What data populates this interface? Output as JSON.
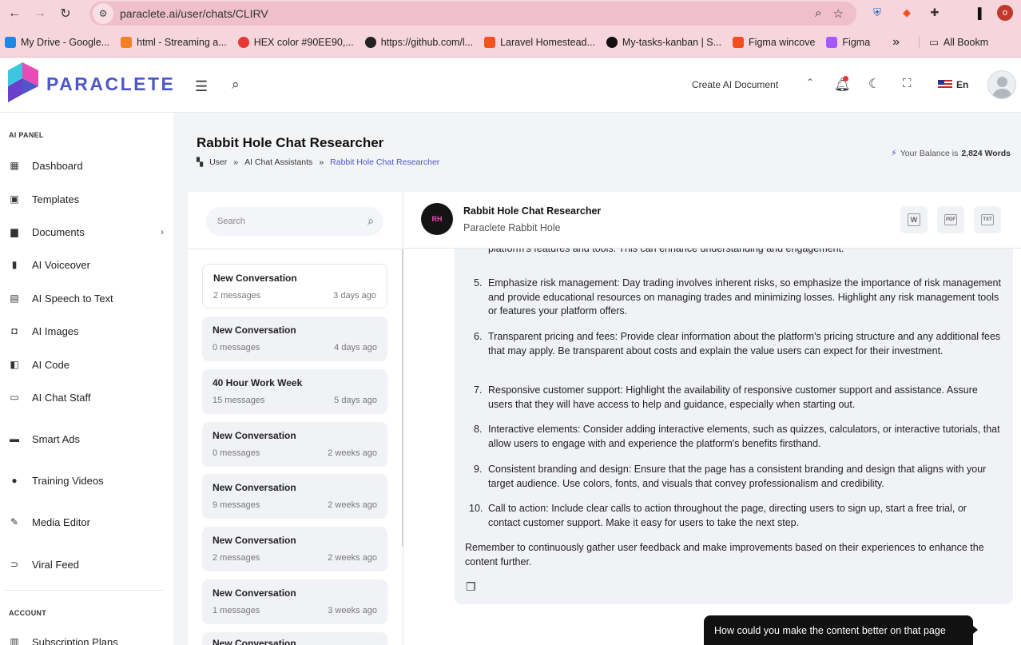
{
  "browser": {
    "url": "paraclete.ai/user/chats/CLIRV",
    "profile_initial": "o",
    "bookmarks": [
      {
        "label": "My Drive - Google...",
        "color": "#1e88e5"
      },
      {
        "label": "html - Streaming a...",
        "color": "#f48024"
      },
      {
        "label": "HEX color #90EE90,...",
        "color": "#e53935"
      },
      {
        "label": "https://github.com/l...",
        "color": "#222222"
      },
      {
        "label": "Laravel Homestead...",
        "color": "#f4511e"
      },
      {
        "label": "My-tasks-kanban | S...",
        "color": "#111111"
      },
      {
        "label": "Figma wincove",
        "color": "#f24e1e"
      },
      {
        "label": "Figma",
        "color": "#a259ff"
      }
    ],
    "more_bookmarks": "»",
    "all_bookmarks": "All Bookm"
  },
  "header": {
    "brand": "PARACLETE",
    "create_doc": "Create AI Document",
    "language": "En"
  },
  "sidebar": {
    "section_ai": "AI PANEL",
    "items": [
      {
        "label": "Dashboard",
        "icon": "dashboard-icon",
        "glyph": "▦"
      },
      {
        "label": "Templates",
        "icon": "templates-icon",
        "glyph": "▣"
      },
      {
        "label": "Documents",
        "icon": "documents-icon",
        "glyph": "▆"
      },
      {
        "label": "AI Voiceover",
        "icon": "voiceover-icon",
        "glyph": "▮"
      },
      {
        "label": "AI Speech to Text",
        "icon": "speech-icon",
        "glyph": "▤"
      },
      {
        "label": "AI Images",
        "icon": "images-icon",
        "glyph": "◘"
      },
      {
        "label": "AI Code",
        "icon": "code-icon",
        "glyph": "◧"
      },
      {
        "label": "AI Chat Staff",
        "icon": "chat-staff-icon",
        "glyph": "▭"
      },
      {
        "label": "Smart Ads",
        "icon": "ads-icon",
        "glyph": "▬"
      },
      {
        "label": "Training Videos",
        "icon": "video-icon",
        "glyph": "●"
      },
      {
        "label": "Media Editor",
        "icon": "edit-icon",
        "glyph": "✎"
      },
      {
        "label": "Viral Feed",
        "icon": "rss-icon",
        "glyph": "⊃"
      }
    ],
    "section_account": "ACCOUNT",
    "account_items": [
      {
        "label": "Subscription Plans",
        "icon": "plans-icon",
        "glyph": "▥"
      }
    ]
  },
  "page": {
    "title": "Rabbit Hole Chat Researcher",
    "breadcrumb": [
      "User",
      "AI Chat Assistants",
      "Rabbit Hole Chat Researcher"
    ],
    "balance_label": "Your Balance is",
    "balance_value": "2,824 Words"
  },
  "conversations": {
    "search_placeholder": "Search",
    "items": [
      {
        "title": "New Conversation",
        "messages": "2 messages",
        "date": "3 days ago"
      },
      {
        "title": "New Conversation",
        "messages": "0 messages",
        "date": "4 days ago"
      },
      {
        "title": "40 Hour Work Week",
        "messages": "15 messages",
        "date": "5 days ago"
      },
      {
        "title": "New Conversation",
        "messages": "0 messages",
        "date": "2 weeks ago"
      },
      {
        "title": "New Conversation",
        "messages": "9 messages",
        "date": "2 weeks ago"
      },
      {
        "title": "New Conversation",
        "messages": "2 messages",
        "date": "2 weeks ago"
      },
      {
        "title": "New Conversation",
        "messages": "1 messages",
        "date": "3 weeks ago"
      },
      {
        "title": "New Conversation",
        "messages": "",
        "date": ""
      }
    ]
  },
  "chat": {
    "bot_name": "Rabbit Hole Chat Researcher",
    "bot_subtitle": "Paraclete Rabbit Hole",
    "bot_initials": "RH",
    "exports": [
      "W",
      "PDF",
      "TXT"
    ],
    "cut_line": "platform's features and tools. This can enhance understanding and engagement.",
    "list": [
      {
        "num": "5.",
        "text": "Emphasize risk management: Day trading involves inherent risks, so emphasize the importance of risk management and provide educational resources on managing trades and minimizing losses. Highlight any risk management tools or features your platform offers."
      },
      {
        "num": "6.",
        "text": "Transparent pricing and fees: Provide clear information about the platform's pricing structure and any additional fees that may apply. Be transparent about costs and explain the value users can expect for their investment."
      },
      {
        "num": "7.",
        "text": "Responsive customer support: Highlight the availability of responsive customer support and assistance. Assure users that they will have access to help and guidance, especially when starting out."
      },
      {
        "num": "8.",
        "text": "Interactive elements: Consider adding interactive elements, such as quizzes, calculators, or interactive tutorials, that allow users to engage with and experience the platform's benefits firsthand."
      },
      {
        "num": "9.",
        "text": "Consistent branding and design: Ensure that the page has a consistent branding and design that aligns with your target audience. Use colors, fonts, and visuals that convey professionalism and credibility."
      },
      {
        "num": "10.",
        "text": "Call to action: Include clear calls to action throughout the page, directing users to sign up, start a free trial, or contact customer support. Make it easy for users to take the next step."
      }
    ],
    "outro": "Remember to continuously gather user feedback and make improvements based on their experiences to enhance the content further.",
    "user_message": "How could you make the content better on that page"
  }
}
